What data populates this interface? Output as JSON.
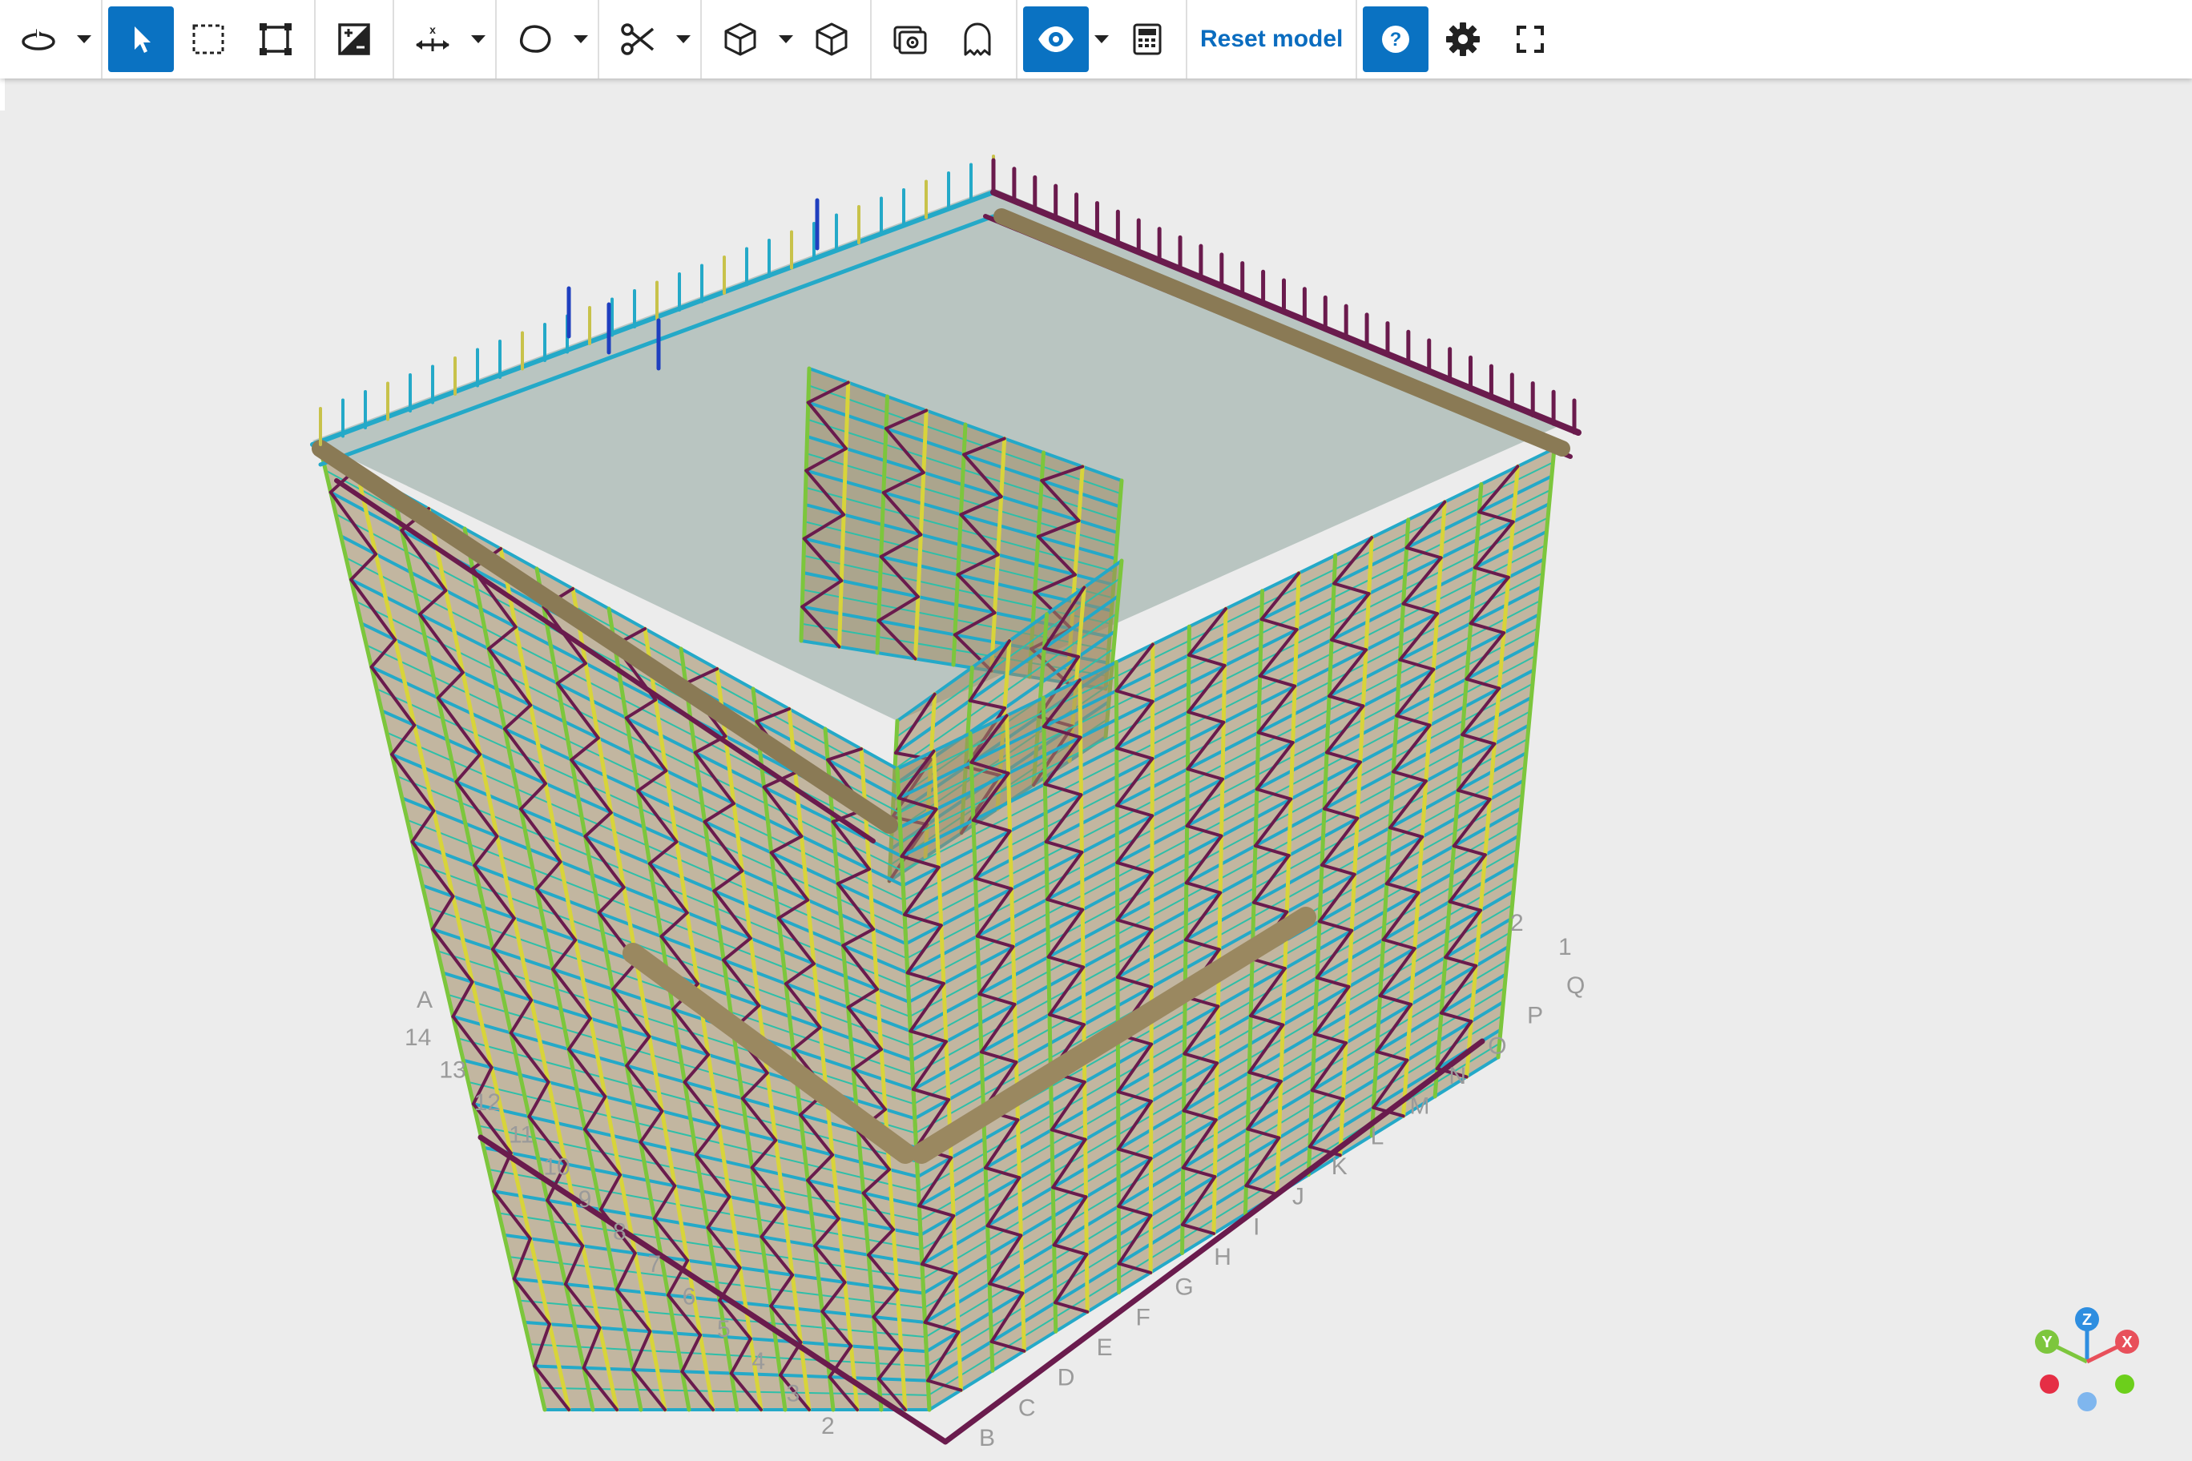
{
  "toolbar": {
    "orbit": {
      "icon": "orbit-icon"
    },
    "select": {
      "icon": "cursor-arrow-icon",
      "active": true
    },
    "box_select": {
      "icon": "dashed-rectangle-icon"
    },
    "fit": {
      "icon": "fit-to-view-icon"
    },
    "render_mode": {
      "icon": "shading-toggle-icon"
    },
    "axis_constraint": {
      "icon": "axis-x-arrows-icon",
      "label": "x"
    },
    "lasso": {
      "icon": "lasso-icon"
    },
    "section": {
      "icon": "scissors-icon"
    },
    "box_view": {
      "icon": "cube-wireframe-icon"
    },
    "solid_view": {
      "icon": "cube-solid-icon"
    },
    "photo": {
      "icon": "image-layers-icon"
    },
    "ghost": {
      "icon": "ghost-icon"
    },
    "visibility": {
      "icon": "eye-icon",
      "active": true
    },
    "calculator": {
      "icon": "calculator-icon"
    },
    "reset_label": "Reset model",
    "help": {
      "icon": "question-mark-icon",
      "active": true
    },
    "settings": {
      "icon": "gear-icon"
    },
    "fullscreen": {
      "icon": "fullscreen-icon"
    }
  },
  "grid_labels": {
    "numbers_left": [
      "14",
      "13",
      "12",
      "11",
      "10",
      "9",
      "8",
      "7",
      "6",
      "5",
      "4",
      "3",
      "2"
    ],
    "letters_left": [
      "A"
    ],
    "numbers_right": [
      "2",
      "1"
    ],
    "letters_right": [
      "Q",
      "P",
      "O",
      "N",
      "M",
      "L",
      "K",
      "J",
      "I",
      "H",
      "G",
      "F",
      "E",
      "D",
      "C",
      "B"
    ]
  },
  "axes_gizmo": {
    "z": "Z",
    "y": "Y",
    "x": "X"
  },
  "colors": {
    "accent": "#0a72c2",
    "reset_text": "#0a6cbf",
    "ledger_cyan": "#24a9c8",
    "standard_yellow": "#d8d43a",
    "standard_green": "#7cc63c",
    "brace_purple": "#6a1b4d",
    "deck_brown": "#a08a62",
    "gizmo_x": "#e8505b",
    "gizmo_y": "#7dc63d",
    "gizmo_z": "#2e8ee0"
  }
}
